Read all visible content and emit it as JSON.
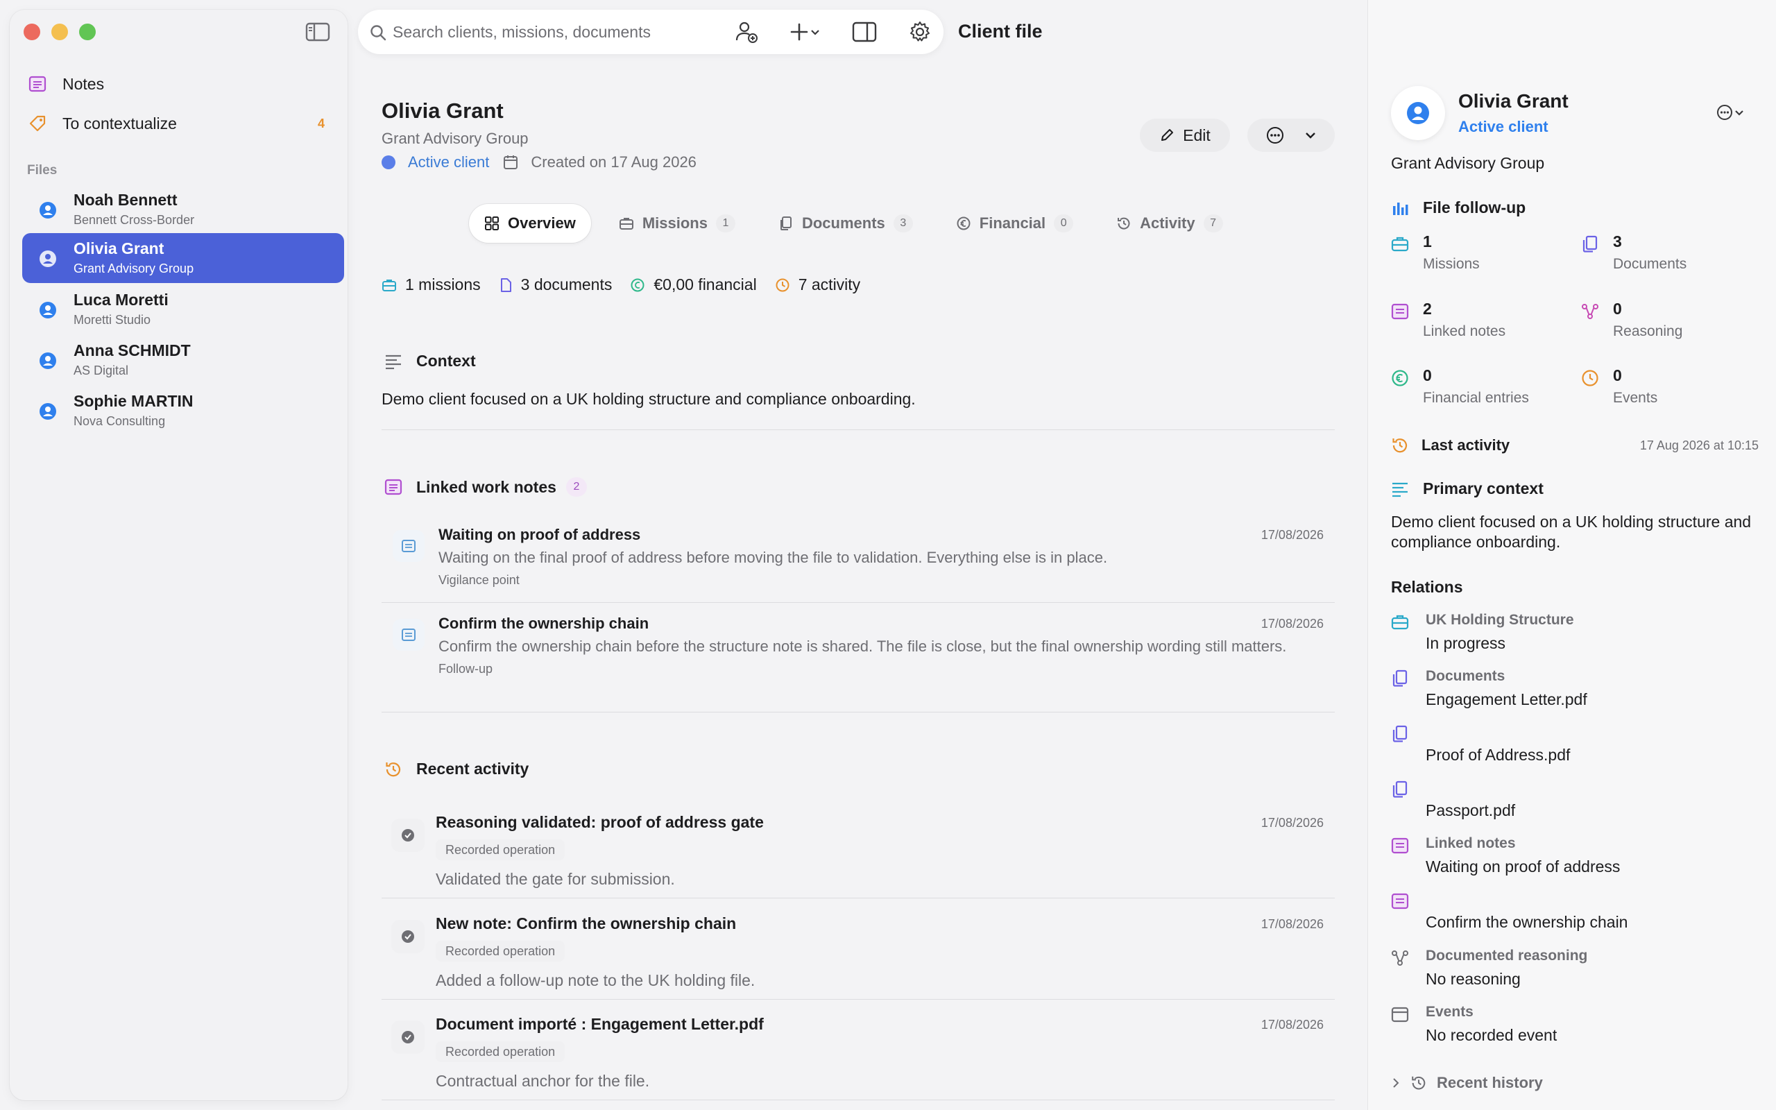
{
  "sidebar": {
    "nav": [
      {
        "label": "Notes",
        "icon": "notes-icon"
      },
      {
        "label": "To contextualize",
        "icon": "tag-icon",
        "badge": "4"
      }
    ],
    "files_heading": "Files",
    "clients": [
      {
        "name": "Noah Bennett",
        "org": "Bennett Cross-Border"
      },
      {
        "name": "Olivia Grant",
        "org": "Grant Advisory Group",
        "active": true
      },
      {
        "name": "Luca Moretti",
        "org": "Moretti Studio"
      },
      {
        "name": "Anna SCHMIDT",
        "org": "AS Digital"
      },
      {
        "name": "Sophie MARTIN",
        "org": "Nova Consulting"
      }
    ]
  },
  "toolbar": {
    "search_placeholder": "Search clients, missions, documents",
    "title": "Client file"
  },
  "client": {
    "name": "Olivia Grant",
    "org": "Grant Advisory Group",
    "status": "Active client",
    "created": "Created on 17 Aug 2026",
    "edit_label": "Edit"
  },
  "tabs": [
    {
      "label": "Overview",
      "count": ""
    },
    {
      "label": "Missions",
      "count": "1"
    },
    {
      "label": "Documents",
      "count": "3"
    },
    {
      "label": "Financial",
      "count": "0"
    },
    {
      "label": "Activity",
      "count": "7"
    }
  ],
  "summary": {
    "missions": "1 missions",
    "documents": "3 documents",
    "financial": "€0,00 financial",
    "activity": "7 activity"
  },
  "context": {
    "heading": "Context",
    "text": "Demo client focused on a UK holding structure and compliance onboarding."
  },
  "linked_notes": {
    "heading": "Linked work notes",
    "count": "2",
    "items": [
      {
        "title": "Waiting on proof of address",
        "date": "17/08/2026",
        "body": "Waiting on the final proof of address before moving the file to validation. Everything else is in place.",
        "tag": "Vigilance point"
      },
      {
        "title": "Confirm the ownership chain",
        "date": "17/08/2026",
        "body": "Confirm the ownership chain before the structure note is shared. The file is close, but the final ownership wording still matters.",
        "tag": "Follow-up"
      }
    ]
  },
  "recent_activity": {
    "heading": "Recent activity",
    "items": [
      {
        "title": "Reasoning validated: proof of address gate",
        "date": "17/08/2026",
        "tag": "Recorded operation",
        "body": "Validated the gate for submission."
      },
      {
        "title": "New note: Confirm the ownership chain",
        "date": "17/08/2026",
        "tag": "Recorded operation",
        "body": "Added a follow-up note to the UK holding file."
      },
      {
        "title": "Document importé : Engagement Letter.pdf",
        "date": "17/08/2026",
        "tag": "Recorded operation",
        "body": "Contractual anchor for the file."
      }
    ]
  },
  "panel": {
    "name": "Olivia Grant",
    "status": "Active client",
    "org": "Grant Advisory Group",
    "followup_heading": "File follow-up",
    "stats": [
      {
        "value": "1",
        "label": "Missions"
      },
      {
        "value": "3",
        "label": "Documents"
      },
      {
        "value": "2",
        "label": "Linked notes"
      },
      {
        "value": "0",
        "label": "Reasoning"
      },
      {
        "value": "0",
        "label": "Financial entries"
      },
      {
        "value": "0",
        "label": "Events"
      }
    ],
    "last_activity_label": "Last activity",
    "last_activity_value": "17 Aug 2026 at 10:15",
    "primary_context_heading": "Primary context",
    "primary_context": "Demo client focused on a UK holding structure and compliance onboarding.",
    "relations_heading": "Relations",
    "relations": [
      {
        "title": "UK Holding Structure",
        "value": "In progress"
      },
      {
        "title": "Documents",
        "value": "Engagement Letter.pdf"
      },
      {
        "title": "",
        "value": "Proof of Address.pdf"
      },
      {
        "title": "",
        "value": "Passport.pdf"
      },
      {
        "title": "Linked notes",
        "value": "Waiting on proof of address"
      },
      {
        "title": "",
        "value": "Confirm the ownership chain"
      },
      {
        "title": "Documented reasoning",
        "value": "No reasoning"
      },
      {
        "title": "Events",
        "value": "No recorded event"
      }
    ],
    "recent_history": "Recent history"
  },
  "colors": {
    "accent": "#4b61d8",
    "status_blue": "#2f80ed",
    "badge_orange": "#e8912d",
    "note_purple": "#9c4bbd",
    "mission_teal": "#2aa9c9"
  }
}
